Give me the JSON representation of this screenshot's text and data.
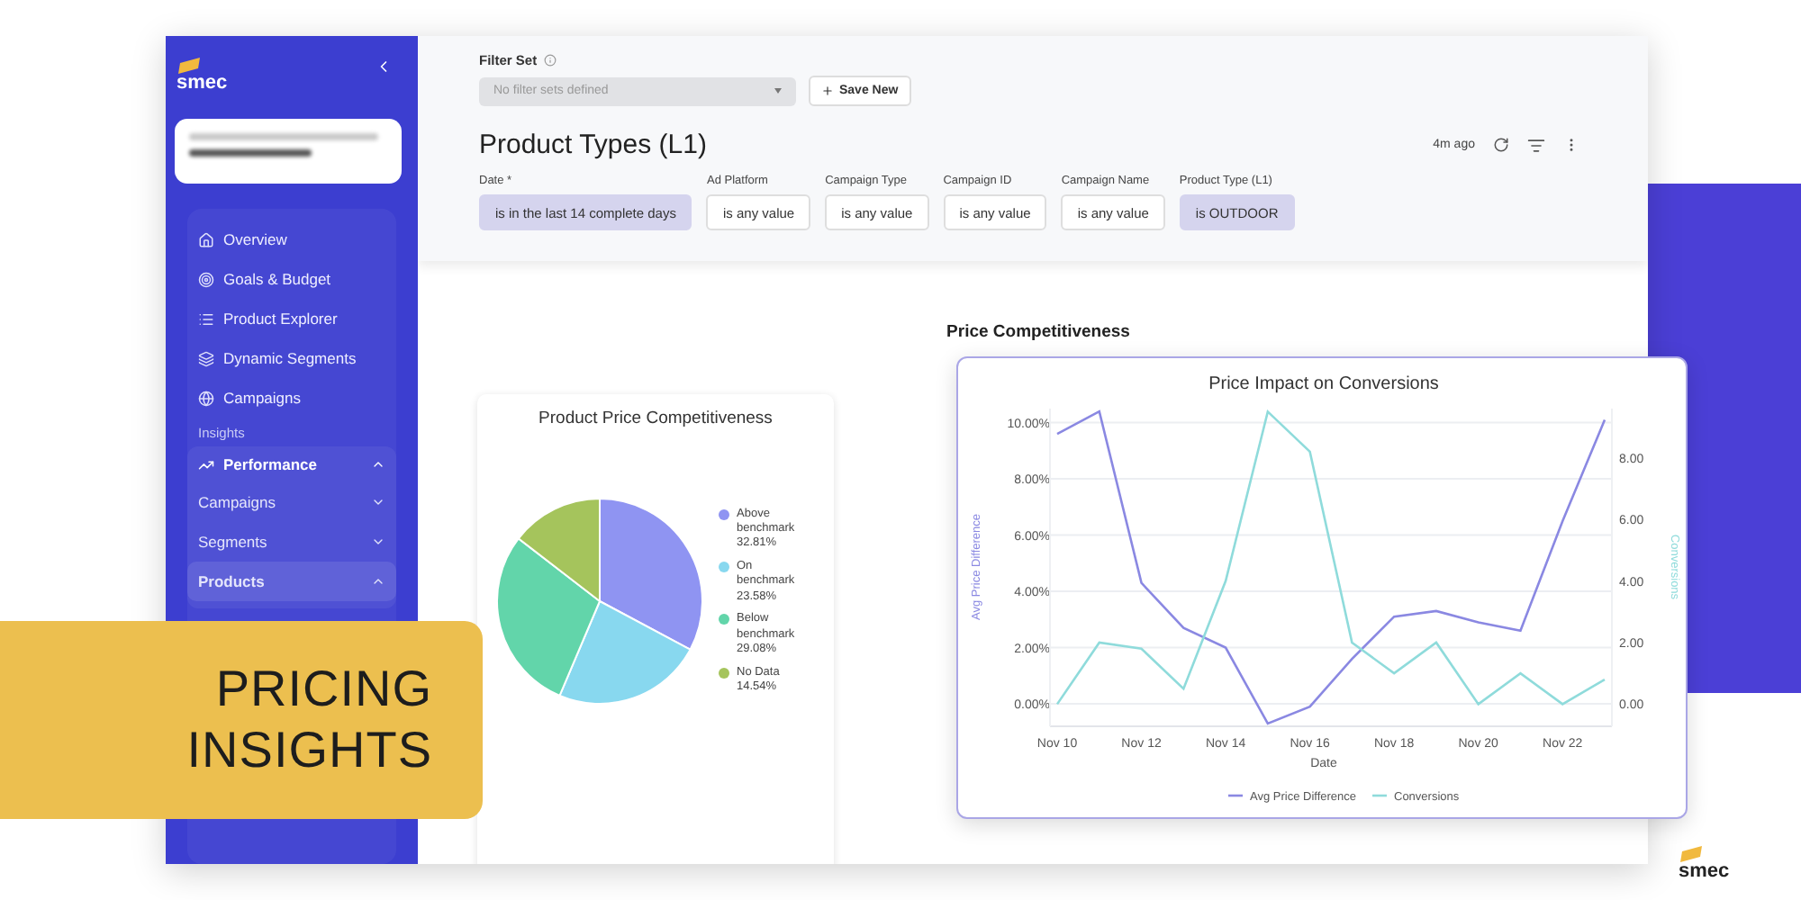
{
  "sidebar": {
    "logo": "smec",
    "items": [
      {
        "kind": "link",
        "label": "Overview"
      },
      {
        "kind": "link",
        "label": "Goals & Budget"
      },
      {
        "kind": "link",
        "label": "Product Explorer"
      },
      {
        "kind": "link",
        "label": "Dynamic Segments"
      },
      {
        "kind": "link",
        "label": "Campaigns"
      },
      {
        "kind": "heading",
        "label": "Insights"
      },
      {
        "kind": "group",
        "label": "Performance",
        "expanded": true,
        "children": [
          {
            "label": "Campaigns",
            "expanded": false,
            "selected": false
          },
          {
            "label": "Segments",
            "expanded": false,
            "selected": false
          },
          {
            "label": "Products",
            "expanded": true,
            "selected": true
          }
        ]
      }
    ]
  },
  "filter_set": {
    "label": "Filter Set",
    "select": {
      "placeholder": "No filter sets defined",
      "disabled": true
    },
    "save_button": "Save New"
  },
  "report": {
    "title": "Product Types (L1)",
    "updated": "4m ago",
    "filters": [
      {
        "label": "Date *",
        "value": "is in the last 14 complete days",
        "active": true
      },
      {
        "label": "Ad Platform",
        "value": "is any value",
        "active": false
      },
      {
        "label": "Campaign Type",
        "value": "is any value",
        "active": false
      },
      {
        "label": "Campaign ID",
        "value": "is any value",
        "active": false
      },
      {
        "label": "Campaign Name",
        "value": "is any value",
        "active": false
      },
      {
        "label": "Product Type (L1)",
        "value": "is OUTDOOR",
        "active": true
      }
    ]
  },
  "section_title": "Price Competitiveness",
  "pie_card": {
    "chart_data": {
      "type": "pie",
      "title": "Product Price Competitiveness",
      "categories": [
        "Above benchmark",
        "On benchmark",
        "Below benchmark",
        "No Data"
      ],
      "values": [
        32.81,
        23.58,
        29.08,
        14.54
      ],
      "value_labels": [
        "32.81%",
        "23.58%",
        "29.08%",
        "14.54%"
      ],
      "colors": [
        "#8f94f2",
        "#88d8ef",
        "#62d5aa",
        "#a5c45c"
      ],
      "legend": "right"
    }
  },
  "line_card": {
    "chart_data": {
      "type": "line",
      "title": "Price Impact on Conversions",
      "xlabel": "Date",
      "ylabel": "Avg Price Difference",
      "y2label": "Conversions",
      "legend": "bottom",
      "categories": [
        "Nov 10",
        null,
        "Nov 12",
        null,
        "Nov 14",
        null,
        "Nov 16",
        null,
        "Nov 18",
        null,
        "Nov 20",
        null,
        "Nov 22",
        null
      ],
      "grid": true,
      "ylim": [
        -0.8,
        10.5
      ],
      "y2lim": [
        -0.72,
        9.6
      ],
      "yticks": [
        {
          "value": 0,
          "label": "0.00%"
        },
        {
          "value": 2,
          "label": "2.00%"
        },
        {
          "value": 4,
          "label": "4.00%"
        },
        {
          "value": 6,
          "label": "6.00%"
        },
        {
          "value": 8,
          "label": "8.00%"
        },
        {
          "value": 10,
          "label": "10.00%"
        }
      ],
      "y2ticks": [
        {
          "value": 0,
          "label": "0.00"
        },
        {
          "value": 2,
          "label": "2.00"
        },
        {
          "value": 4,
          "label": "4.00"
        },
        {
          "value": 6,
          "label": "6.00"
        },
        {
          "value": 8,
          "label": "8.00"
        }
      ],
      "series": [
        {
          "name": "Avg Price Difference",
          "color": "#8a88e2",
          "values": [
            9.6,
            10.4,
            4.3,
            2.7,
            2.0,
            -0.7,
            -0.1,
            1.6,
            3.1,
            3.3,
            2.9,
            2.6,
            6.5,
            10.1
          ]
        },
        {
          "name": "Conversions",
          "color": "#8fdbdb",
          "axis": "y2",
          "values": [
            0,
            2,
            1.8,
            0.5,
            4,
            9.5,
            8.2,
            2,
            1,
            2,
            0,
            1,
            0,
            0.8
          ]
        }
      ]
    }
  },
  "banner": {
    "lines": [
      "PRICING",
      "INSIGHTS"
    ]
  },
  "footer_logo": "smec"
}
